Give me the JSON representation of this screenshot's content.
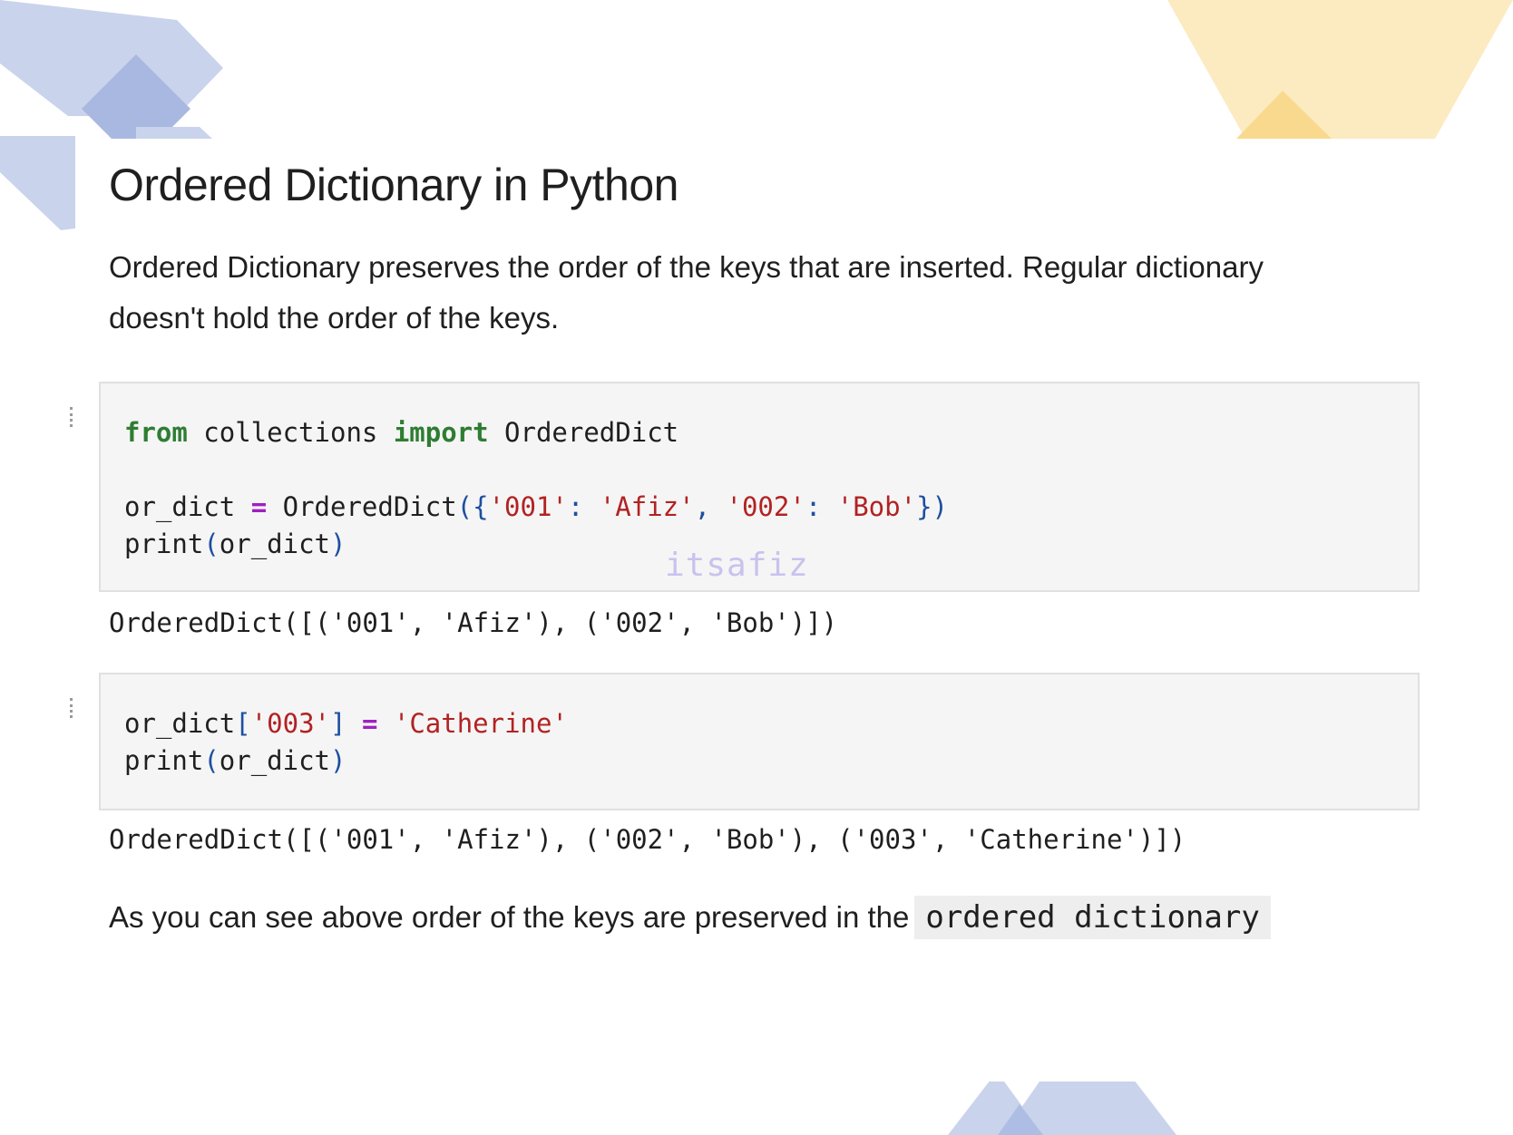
{
  "colors": {
    "accent_blue": "#c9d3ec",
    "accent_yellow": "#fcebc1",
    "keyword": "#2e7d32",
    "string": "#b22222",
    "operator": "#a020c0",
    "bracket": "#1d4fa0"
  },
  "article": {
    "title": "Ordered Dictionary in Python",
    "intro": "Ordered Dictionary preserves the order of the keys that are inserted. Regular dictionary doesn't hold the order of the keys.",
    "watermark": "itsafiz",
    "cell1": {
      "kw_from": "from",
      "mod_name": " collections ",
      "kw_import": "import",
      "cls_name": " OrderedDict",
      "l2_var": "or_dict ",
      "l2_eq": "=",
      "l2_func": " OrderedDict",
      "l2_open": "({",
      "l2_k1": "'001'",
      "l2_c1": ": ",
      "l2_v1": "'Afiz'",
      "l2_sep": ", ",
      "l2_k2": "'002'",
      "l2_c2": ": ",
      "l2_v2": "'Bob'",
      "l2_close": "})",
      "l3_func": "print",
      "l3_open": "(",
      "l3_arg": "or_dict",
      "l3_close": ")"
    },
    "output1": "OrderedDict([('001', 'Afiz'), ('002', 'Bob')])",
    "cell2": {
      "l1_var": "or_dict",
      "l1_open": "[",
      "l1_key": "'003'",
      "l1_close": "]",
      "l1_eq": "=",
      "l1_val": "'Catherine'",
      "l2_func": "print",
      "l2_open": "(",
      "l2_arg": "or_dict",
      "l2_close": ")"
    },
    "output2": "OrderedDict([('001', 'Afiz'), ('002', 'Bob'), ('003', 'Catherine')])",
    "conclusion_text": "As you can see above order of the keys are preserved in the",
    "conclusion_code": "ordered dictionary"
  }
}
